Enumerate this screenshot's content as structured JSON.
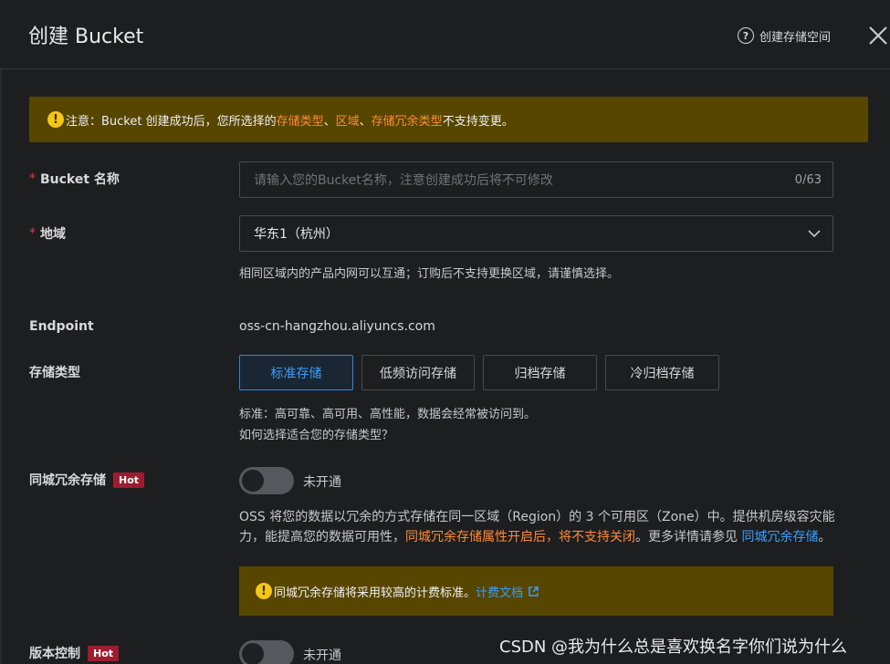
{
  "header": {
    "title": "创建 Bucket",
    "help_label": "创建存储空间"
  },
  "notice": {
    "prefix": "注意：Bucket 创建成功后，您所选择的 ",
    "link1": "存储类型",
    "sep1": "、",
    "link2": "区域",
    "sep2": "、",
    "link3": "存储冗余类型",
    "suffix": " 不支持变更。"
  },
  "bucket_name": {
    "label": "Bucket 名称",
    "placeholder": "请输入您的Bucket名称，注意创建成功后将不可修改",
    "count": "0/63"
  },
  "region": {
    "label": "地域",
    "value": "华东1（杭州）",
    "help": "相同区域内的产品内网可以互通；订购后不支持更换区域，请谨慎选择。"
  },
  "endpoint": {
    "label": "Endpoint",
    "value": "oss-cn-hangzhou.aliyuncs.com"
  },
  "storage_class": {
    "label": "存储类型",
    "options": [
      "标准存储",
      "低频访问存储",
      "归档存储",
      "冷归档存储"
    ],
    "selected": "标准存储",
    "desc": "标准：高可靠、高可用、高性能，数据会经常被访问到。",
    "link": "如何选择适合您的存储类型？"
  },
  "zrs": {
    "label": "同城冗余存储",
    "hot": "Hot",
    "status": "未开通",
    "enabled": false,
    "desc_part1": "OSS 将您的数据以冗余的方式存储在同一区域（Region）的 3 个可用区（Zone）中。提供机房级容灾能力，能提高您的数据可用性，",
    "desc_warn": "同城冗余存储属性开启后，将不支持关闭",
    "desc_part2": "。更多详情请参见 ",
    "desc_link": "同城冗余存储",
    "desc_end": "。",
    "notice": "同城冗余存储将采用较高的计费标准。",
    "notice_link": "计费文档"
  },
  "versioning": {
    "label": "版本控制",
    "hot": "Hot",
    "status": "未开通",
    "enabled": false
  },
  "watermark": "CSDN @我为什么总是喜欢换名字你们说为什么",
  "colors": {
    "background": "#1d1e20",
    "notice_bg": "#574600",
    "accent_blue": "#3aa0ff",
    "warn_orange": "#ff8a3a",
    "hot_badge": "#9e1c2f"
  }
}
